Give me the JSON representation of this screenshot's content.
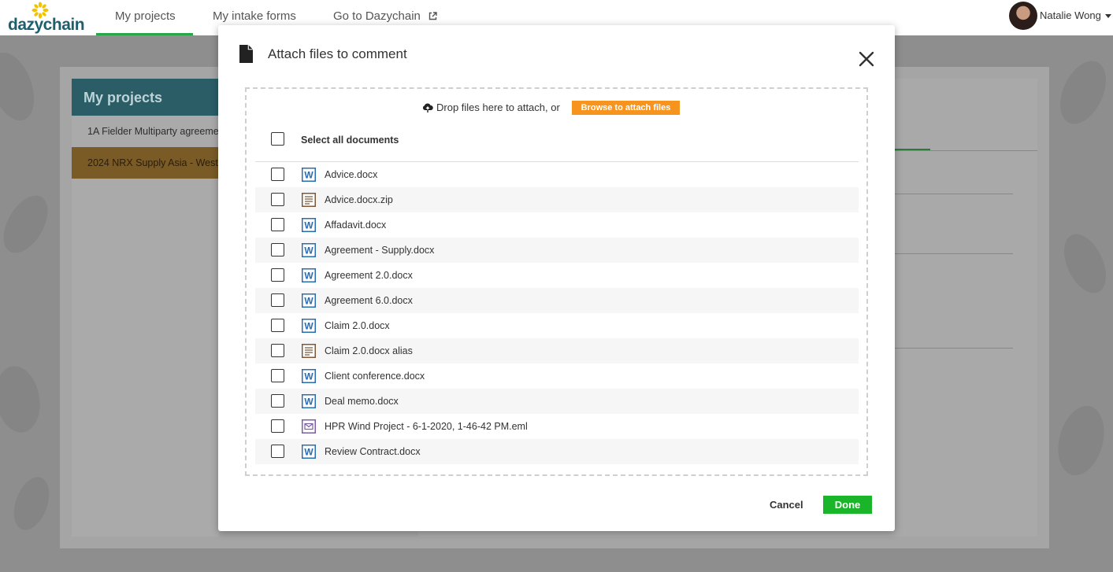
{
  "app": {
    "logo_text": "dazychain",
    "nav": [
      {
        "label": "My projects",
        "active": true
      },
      {
        "label": "My intake forms",
        "active": false
      },
      {
        "label": "Go to Dazychain",
        "active": false,
        "external": true
      }
    ],
    "user": {
      "name": "Natalie Wong"
    }
  },
  "background": {
    "sidebar_title": "My projects",
    "projects": [
      {
        "name": "1A Fielder Multiparty agreeme",
        "selected": false
      },
      {
        "name": "2024 NRX Supply Asia - West",
        "selected": true
      }
    ]
  },
  "modal": {
    "title": "Attach files to comment",
    "drop_text": "Drop files here to attach, or",
    "browse_label": "Browse to attach files",
    "select_all_label": "Select all documents",
    "files": [
      {
        "name": "Advice.docx",
        "icon": "word-icon"
      },
      {
        "name": "Advice.docx.zip",
        "icon": "text-file-icon"
      },
      {
        "name": "Affadavit.docx",
        "icon": "word-icon"
      },
      {
        "name": "Agreement - Supply.docx",
        "icon": "word-icon"
      },
      {
        "name": "Agreement 2.0.docx",
        "icon": "word-icon"
      },
      {
        "name": "Agreement 6.0.docx",
        "icon": "word-icon"
      },
      {
        "name": "Claim 2.0.docx",
        "icon": "word-icon"
      },
      {
        "name": "Claim 2.0.docx alias",
        "icon": "text-file-icon"
      },
      {
        "name": "Client conference.docx",
        "icon": "word-icon"
      },
      {
        "name": "Deal memo.docx",
        "icon": "word-icon"
      },
      {
        "name": "HPR Wind Project - 6-1-2020, 1-46-42 PM.eml",
        "icon": "email-icon"
      },
      {
        "name": "Review Contract.docx",
        "icon": "word-icon"
      }
    ],
    "cancel_label": "Cancel",
    "done_label": "Done"
  },
  "colors": {
    "accent_green": "#1bb52a",
    "browse_orange": "#f7941d",
    "nav_underline": "#2aa64a",
    "word_blue": "#2b6cb0",
    "text_file_brown": "#7a5a3a",
    "email_purple": "#7b5ea7"
  }
}
